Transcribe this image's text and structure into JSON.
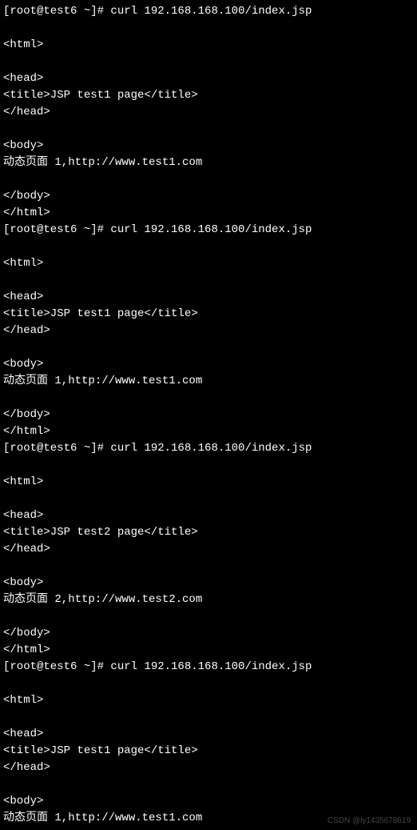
{
  "terminal": {
    "lines": [
      "[root@test6 ~]# curl 192.168.168.100/index.jsp",
      "",
      "<html>",
      "",
      "<head>",
      "<title>JSP test1 page</title>",
      "</head>",
      "",
      "<body>",
      "动态页面 1,http://www.test1.com",
      "",
      "</body>",
      "</html>",
      "[root@test6 ~]# curl 192.168.168.100/index.jsp",
      "",
      "<html>",
      "",
      "<head>",
      "<title>JSP test1 page</title>",
      "</head>",
      "",
      "<body>",
      "动态页面 1,http://www.test1.com",
      "",
      "</body>",
      "</html>",
      "[root@test6 ~]# curl 192.168.168.100/index.jsp",
      "",
      "<html>",
      "",
      "<head>",
      "<title>JSP test2 page</title>",
      "</head>",
      "",
      "<body>",
      "动态页面 2,http://www.test2.com",
      "",
      "</body>",
      "</html>",
      "[root@test6 ~]# curl 192.168.168.100/index.jsp",
      "",
      "<html>",
      "",
      "<head>",
      "<title>JSP test1 page</title>",
      "</head>",
      "",
      "<body>",
      "动态页面 1,http://www.test1.com"
    ]
  },
  "watermark": "CSDN @ly1435678619"
}
